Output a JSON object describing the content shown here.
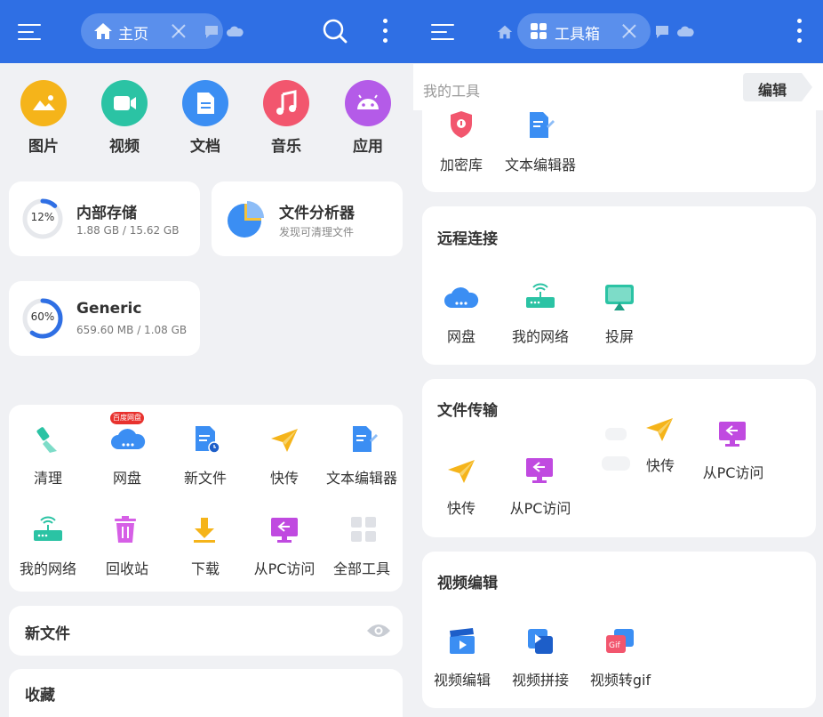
{
  "left": {
    "tab_label": "主页",
    "categories": [
      {
        "label": "图片",
        "icon": "image-icon",
        "color": "#f5b41a"
      },
      {
        "label": "视频",
        "icon": "video-icon",
        "color": "#2bc3a4"
      },
      {
        "label": "文档",
        "icon": "document-icon",
        "color": "#3b8ef3"
      },
      {
        "label": "音乐",
        "icon": "music-icon",
        "color": "#f2566e"
      },
      {
        "label": "应用",
        "icon": "android-icon",
        "color": "#b45be8"
      }
    ],
    "storage": {
      "internal": {
        "title": "内部存储",
        "percent": "12%",
        "usage": "1.88 GB / 15.62 GB",
        "fraction": 0.12
      },
      "analyzer": {
        "title": "文件分析器",
        "subtitle": "发现可清理文件"
      },
      "generic": {
        "title": "Generic",
        "percent": "60%",
        "usage": "659.60 MB / 1.08 GB",
        "fraction": 0.6
      }
    },
    "tools_row1": [
      {
        "label": "清理",
        "icon": "broom-icon"
      },
      {
        "label": "网盘",
        "icon": "cloud-icon",
        "badge": "百度网盘"
      },
      {
        "label": "新文件",
        "icon": "new-file-icon"
      },
      {
        "label": "快传",
        "icon": "paper-plane-icon"
      },
      {
        "label": "文本编辑器",
        "icon": "text-editor-icon"
      }
    ],
    "tools_row2": [
      {
        "label": "我的网络",
        "icon": "router-icon"
      },
      {
        "label": "回收站",
        "icon": "trash-icon"
      },
      {
        "label": "下载",
        "icon": "download-icon"
      },
      {
        "label": "从PC访问",
        "icon": "pc-access-icon"
      },
      {
        "label": "全部工具",
        "icon": "grid-icon"
      }
    ],
    "new_files_title": "新文件",
    "favorites_title": "收藏"
  },
  "right": {
    "tab_label": "工具箱",
    "my_tools_label": "我的工具",
    "edit_label": "编辑",
    "top_tools": [
      {
        "label": "加密库",
        "icon": "vault-icon"
      },
      {
        "label": "文本编辑器",
        "icon": "text-editor-icon"
      }
    ],
    "remote": {
      "title": "远程连接",
      "items": [
        {
          "label": "网盘",
          "icon": "cloud-icon"
        },
        {
          "label": "我的网络",
          "icon": "router-icon"
        },
        {
          "label": "投屏",
          "icon": "cast-icon"
        }
      ]
    },
    "transfer": {
      "title": "文件传输",
      "items": [
        {
          "label": "快传",
          "icon": "paper-plane-icon"
        },
        {
          "label": "从PC访问",
          "icon": "pc-access-icon"
        },
        {
          "label": "快传",
          "icon": "paper-plane-icon"
        },
        {
          "label": "从PC访问",
          "icon": "pc-access-icon"
        }
      ]
    },
    "video": {
      "title": "视频编辑",
      "items": [
        {
          "label": "视频编辑",
          "icon": "clapperboard-icon"
        },
        {
          "label": "视频拼接",
          "icon": "video-merge-icon"
        },
        {
          "label": "视频转gif",
          "icon": "gif-icon"
        }
      ]
    }
  }
}
